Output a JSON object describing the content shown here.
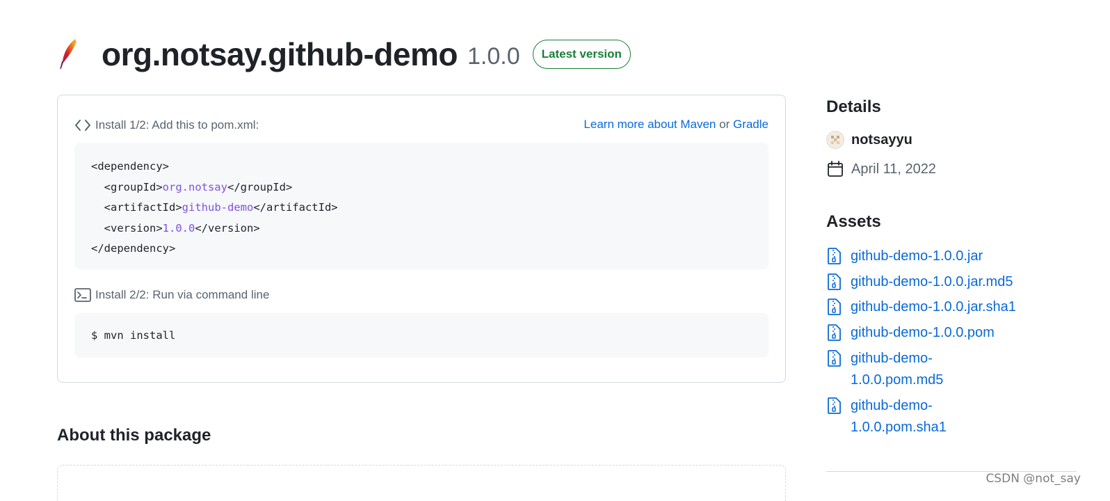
{
  "package": {
    "name": "org.notsay.github-demo",
    "version": "1.0.0",
    "badge": "Latest version",
    "logo_icon": "apache-feather-icon"
  },
  "install": {
    "step1": {
      "label": "Install 1/2: Add this to pom.xml:",
      "icon": "code-icon",
      "learn_prefix": "Learn more about Maven",
      "learn_or": "or",
      "learn_gradle": "Gradle",
      "code": {
        "open": "<dependency>",
        "group_open": "  <groupId>",
        "group_value": "org.notsay",
        "group_close": "</groupId>",
        "artifact_open": "  <artifactId>",
        "artifact_value": "github-demo",
        "artifact_close": "</artifactId>",
        "version_open": "  <version>",
        "version_value": "1.0.0",
        "version_close": "</version>",
        "close": "</dependency>"
      }
    },
    "step2": {
      "label": "Install 2/2: Run via command line",
      "icon": "terminal-icon",
      "command": "$ mvn install"
    }
  },
  "about": {
    "title": "About this package"
  },
  "details": {
    "title": "Details",
    "owner": "notsayyu",
    "date": "April 11, 2022"
  },
  "assets": {
    "title": "Assets",
    "items": [
      "github-demo-1.0.0.jar",
      "github-demo-1.0.0.jar.md5",
      "github-demo-1.0.0.jar.sha1",
      "github-demo-1.0.0.pom",
      "github-demo-1.0.0.pom.md5",
      "github-demo-1.0.0.pom.sha1"
    ]
  },
  "watermark": "CSDN @not_say",
  "colors": {
    "link": "#0969da",
    "badge": "#1a7f37",
    "code_value": "#8250df"
  }
}
